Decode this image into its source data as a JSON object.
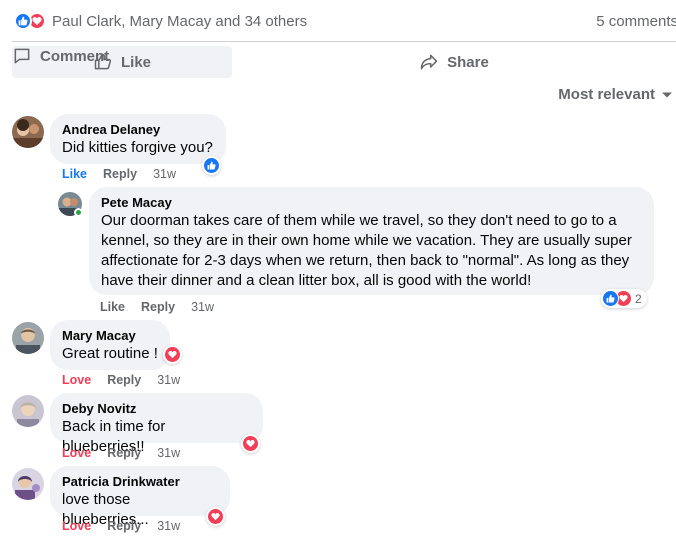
{
  "summary": {
    "names": "Paul Clark, Mary Macay and 34 others",
    "comments": "5 comments"
  },
  "actions": {
    "like": "Like",
    "comment": "Comment",
    "share": "Share"
  },
  "sort": {
    "label": "Most relevant"
  },
  "comments": [
    {
      "author": "Andrea Delaney",
      "text": "Did kitties forgive you?",
      "action": "Like",
      "reply": "Reply",
      "time": "31w",
      "reaction": "like-icon"
    },
    {
      "author": "Pete Macay",
      "text": "Our doorman takes care of them while we travel, so they don't need to go to a kennel, so they are in their own home while we vacation. They are usually super affectionate for 2-3 days when we return, then back to \"normal\". As long as they have their dinner and a clean litter box, all is good with the world!",
      "action": "Like",
      "reply": "Reply",
      "time": "31w",
      "reaction_count": "2"
    },
    {
      "author": "Mary Macay",
      "text": "Great routine !",
      "action": "Love",
      "reply": "Reply",
      "time": "31w",
      "reaction": "heart-icon"
    },
    {
      "author": "Deby Novitz",
      "text": "Back in time for blueberries!!",
      "action": "Love",
      "reply": "Reply",
      "time": "31w",
      "reaction": "heart-icon"
    },
    {
      "author": "Patricia Drinkwater",
      "text": "love those blueberries...",
      "action": "Love",
      "reply": "Reply",
      "time": "31w",
      "reaction": "heart-icon"
    }
  ],
  "colors": {
    "like_blue": "#1877f2",
    "love_red": "#f33e58",
    "bubble_gray": "#f0f2f5",
    "secondary_text": "#65676b"
  }
}
